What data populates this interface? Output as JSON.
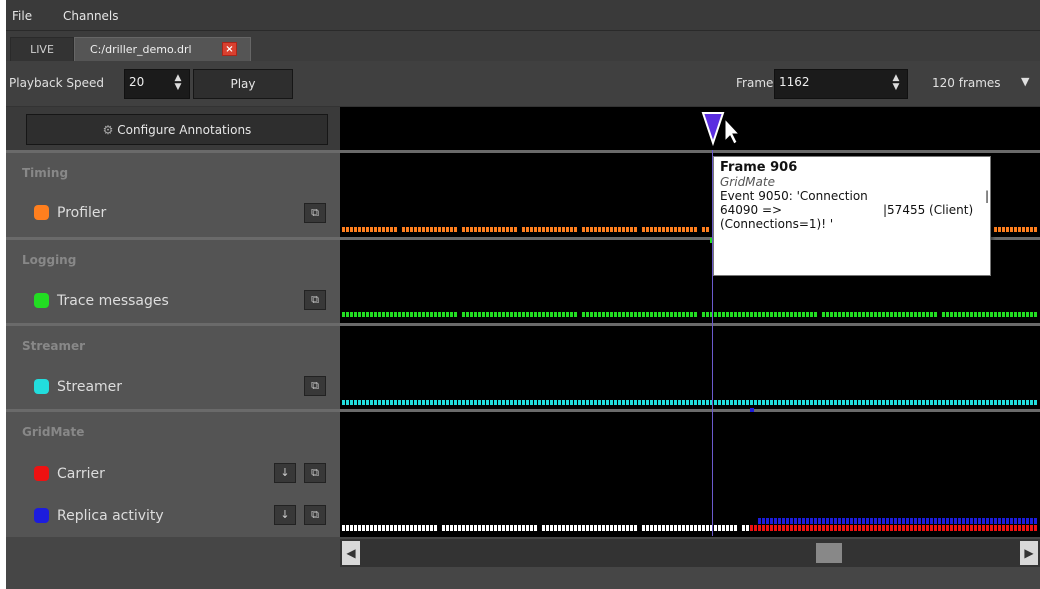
{
  "menu": {
    "file": "File",
    "channels": "Channels"
  },
  "tabs": {
    "live": "LIVE",
    "file": "C:/driller_demo.drl",
    "close": "×"
  },
  "toolbar": {
    "playback_speed_label": "Playback Speed",
    "playback_speed_value": "20",
    "play_label": "Play",
    "frame_label": "Frame",
    "frame_value": "1162",
    "frames_window": "120 frames"
  },
  "annotations": {
    "configure_label": "Configure Annotations"
  },
  "groups": [
    {
      "title": "Timing",
      "channels": [
        {
          "label": "Profiler",
          "color": "#ff7f1e"
        }
      ]
    },
    {
      "title": "Logging",
      "channels": [
        {
          "label": "Trace messages",
          "color": "#22dd22"
        }
      ]
    },
    {
      "title": "Streamer",
      "channels": [
        {
          "label": "Streamer",
          "color": "#22dddd"
        }
      ]
    },
    {
      "title": "GridMate",
      "channels": [
        {
          "label": "Carrier",
          "color": "#ee1111"
        },
        {
          "label": "Replica activity",
          "color": "#1c1cdd"
        }
      ]
    }
  ],
  "tooltip": {
    "title": "Frame 906",
    "subtitle": "GridMate",
    "line1a": "Event 9050: 'Connection",
    "line1b": "|",
    "line2a": "64090 =>",
    "line2b": "|57455 (Client)",
    "line3": "(Connections=1)! '"
  },
  "colors": {
    "marker": "#5b2ee0",
    "panel": "#545454",
    "timeline": "#000000"
  },
  "icons": {
    "gear": "gear-icon",
    "detach": "detach-icon",
    "down_arrow": "down-arrow-icon",
    "scroll_left": "scroll-left-icon",
    "scroll_right": "scroll-right-icon",
    "dropdown": "chevron-down-icon"
  }
}
